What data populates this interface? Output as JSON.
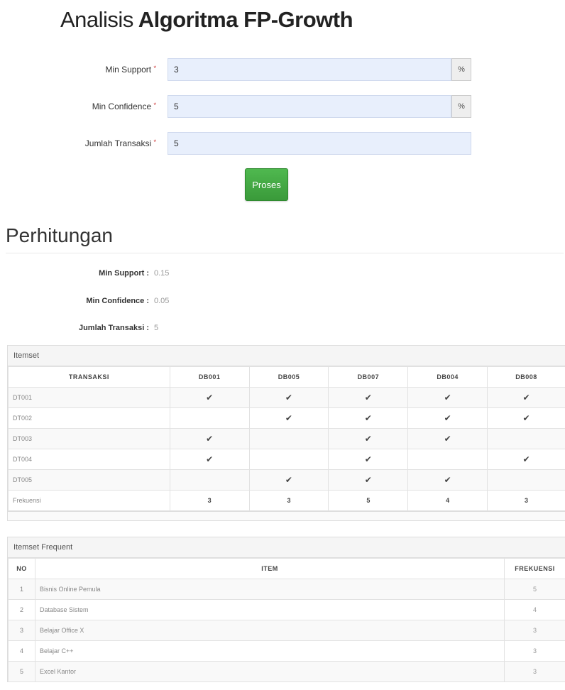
{
  "title": {
    "light": "Analisis",
    "bold": "Algoritma FP-Growth"
  },
  "form": {
    "min_support": {
      "label": "Min Support",
      "required_mark": "*",
      "value": "3",
      "addon": "%"
    },
    "min_confidence": {
      "label": "Min Confidence",
      "required_mark": "*",
      "value": "5",
      "addon": "%"
    },
    "jumlah_transaksi": {
      "label": "Jumlah Transaksi",
      "required_mark": "*",
      "value": "5"
    },
    "submit_label": "Proses"
  },
  "perhitungan": {
    "title": "Perhitungan",
    "min_support": {
      "label": "Min Support :",
      "value": "0.15"
    },
    "min_confidence": {
      "label": "Min Confidence :",
      "value": "0.05"
    },
    "jumlah_transaksi": {
      "label": "Jumlah Transaksi :",
      "value": "5"
    }
  },
  "itemset": {
    "heading": "Itemset",
    "columns": [
      "TRANSAKSI",
      "DB001",
      "DB005",
      "DB007",
      "DB004",
      "DB008"
    ],
    "rows": [
      {
        "id": "DT001",
        "cells": [
          "✔",
          "✔",
          "✔",
          "✔",
          "✔"
        ]
      },
      {
        "id": "DT002",
        "cells": [
          "",
          "✔",
          "✔",
          "✔",
          "✔"
        ]
      },
      {
        "id": "DT003",
        "cells": [
          "✔",
          "",
          "✔",
          "✔",
          ""
        ]
      },
      {
        "id": "DT004",
        "cells": [
          "✔",
          "",
          "✔",
          "",
          "✔"
        ]
      },
      {
        "id": "DT005",
        "cells": [
          "",
          "✔",
          "✔",
          "✔",
          ""
        ]
      }
    ],
    "frekuensi_label": "Frekuensi",
    "frekuensi": [
      "3",
      "3",
      "5",
      "4",
      "3"
    ]
  },
  "itemset_frequent": {
    "heading": "Itemset Frequent",
    "columns": [
      "NO",
      "ITEM",
      "FREKUENSI"
    ],
    "rows": [
      {
        "no": "1",
        "item": "Bisnis Online Pemula",
        "frekuensi": "5"
      },
      {
        "no": "2",
        "item": "Database Sistem",
        "frekuensi": "4"
      },
      {
        "no": "3",
        "item": "Belajar Office X",
        "frekuensi": "3"
      },
      {
        "no": "4",
        "item": "Belajar C++",
        "frekuensi": "3"
      },
      {
        "no": "5",
        "item": "Excel Kantor",
        "frekuensi": "3"
      }
    ]
  }
}
